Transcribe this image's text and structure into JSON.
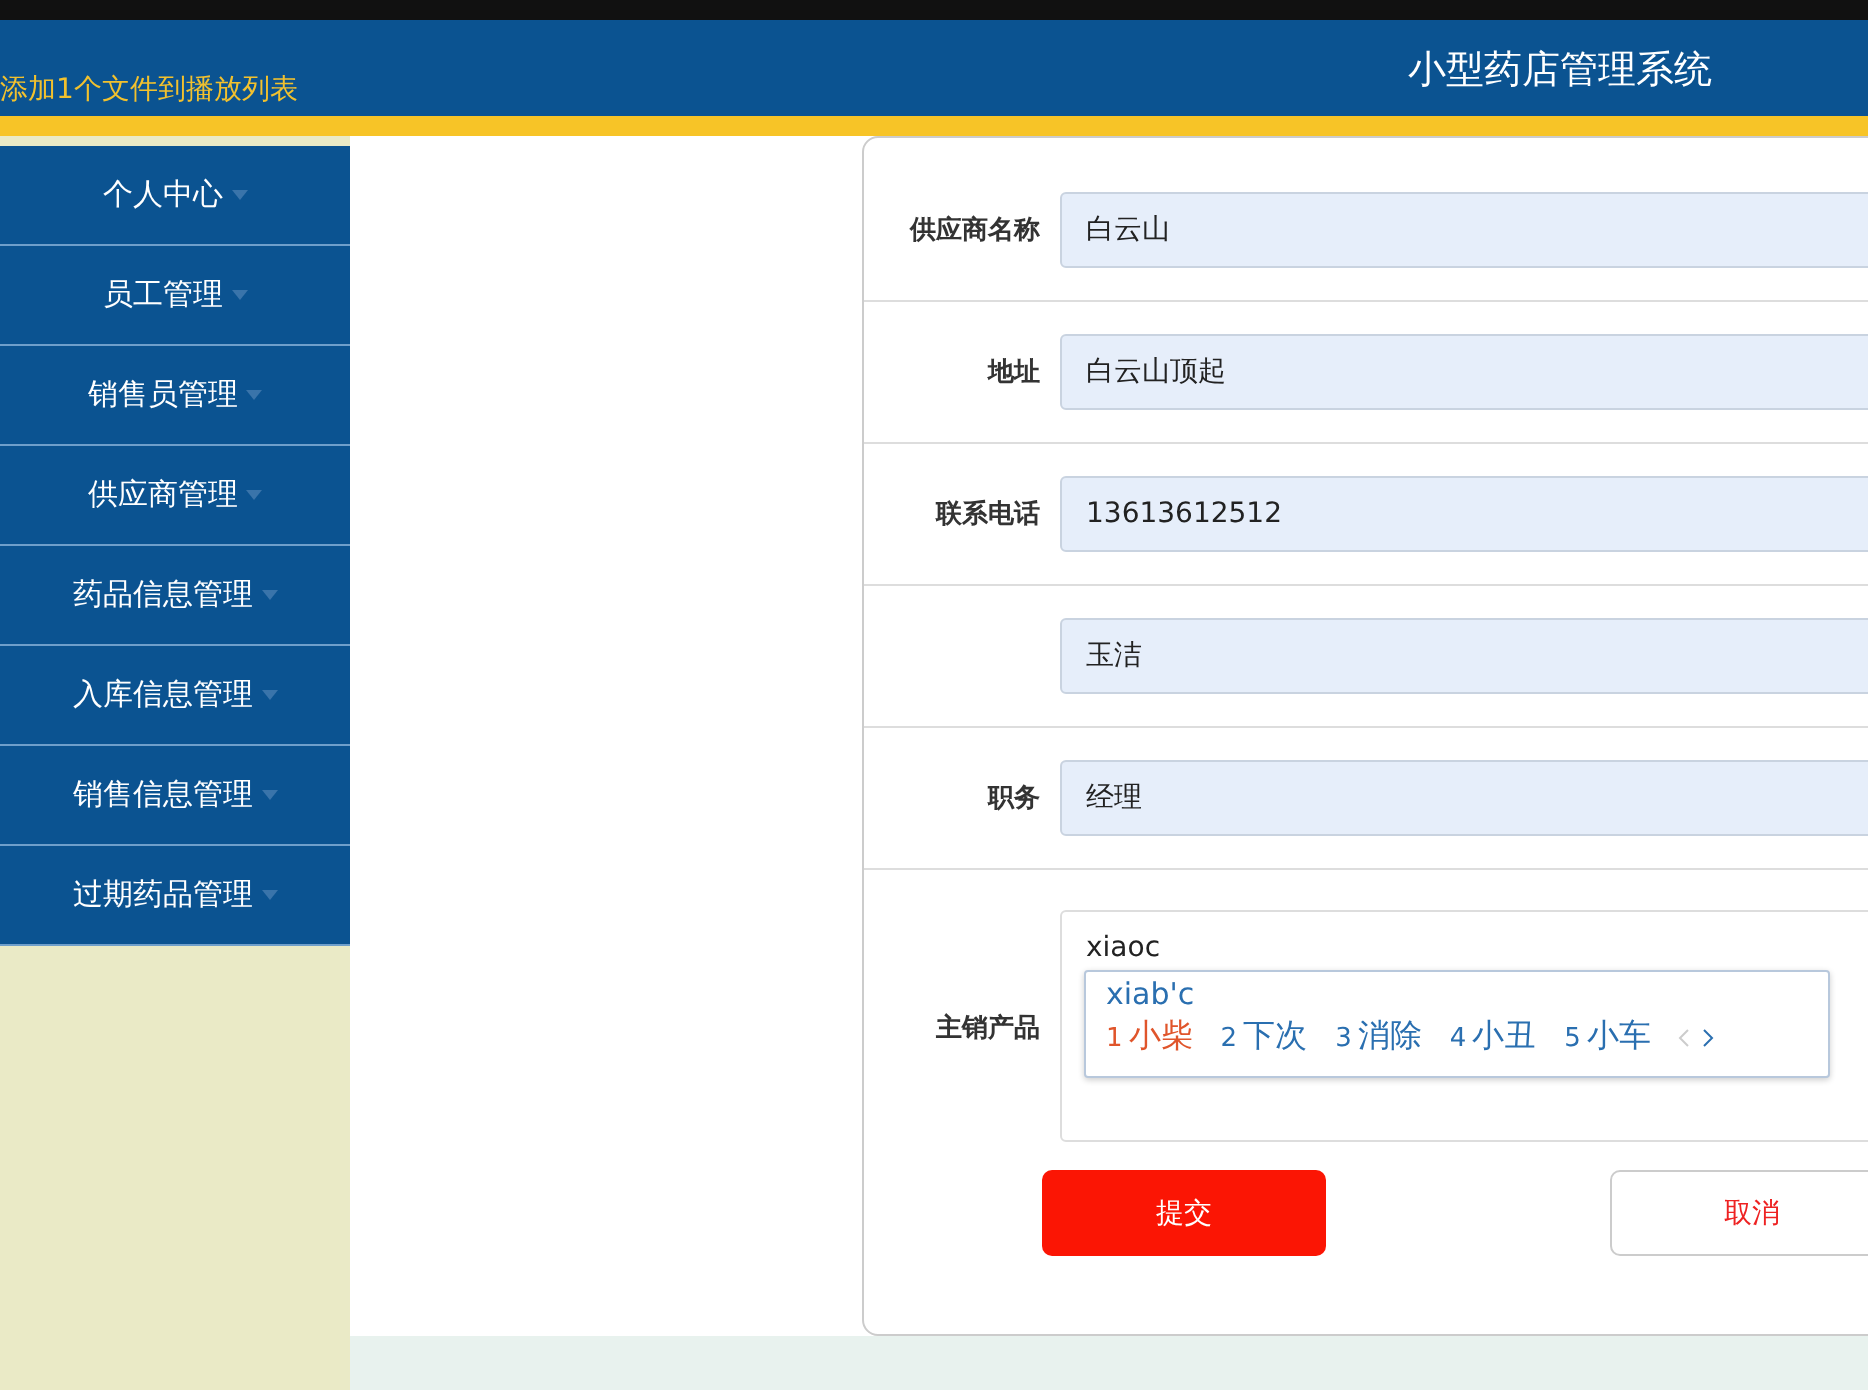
{
  "header": {
    "notice": "添加1个文件到播放列表",
    "title": "小型药店管理系统"
  },
  "sidebar": {
    "items": [
      {
        "label": "个人中心"
      },
      {
        "label": "员工管理"
      },
      {
        "label": "销售员管理"
      },
      {
        "label": "供应商管理"
      },
      {
        "label": "药品信息管理"
      },
      {
        "label": "入库信息管理"
      },
      {
        "label": "销售信息管理"
      },
      {
        "label": "过期药品管理"
      }
    ]
  },
  "form": {
    "fields": [
      {
        "kind": "input",
        "label": "供应商名称",
        "value": "白云山"
      },
      {
        "kind": "input",
        "label": "地址",
        "value": "白云山顶起"
      },
      {
        "kind": "input",
        "label": "联系电话",
        "value": "13613612512"
      },
      {
        "kind": "input",
        "value": "玉洁"
      },
      {
        "kind": "input",
        "label": "职务",
        "value": "经理"
      },
      {
        "kind": "textarea",
        "label": "主销产品",
        "value": "xiaoc"
      }
    ],
    "buttons": [
      {
        "kind": "primary",
        "label": "提交"
      },
      {
        "kind": "secondary",
        "label": "取消"
      }
    ]
  },
  "ime": {
    "composition": "xiab'c",
    "candidates": [
      {
        "number": "1",
        "text": "小柴",
        "selected": true
      },
      {
        "number": "2",
        "text": "下次",
        "selected": false
      },
      {
        "number": "3",
        "text": "消除",
        "selected": false
      },
      {
        "number": "4",
        "text": "小丑",
        "selected": false
      },
      {
        "number": "5",
        "text": "小车",
        "selected": false
      }
    ]
  }
}
